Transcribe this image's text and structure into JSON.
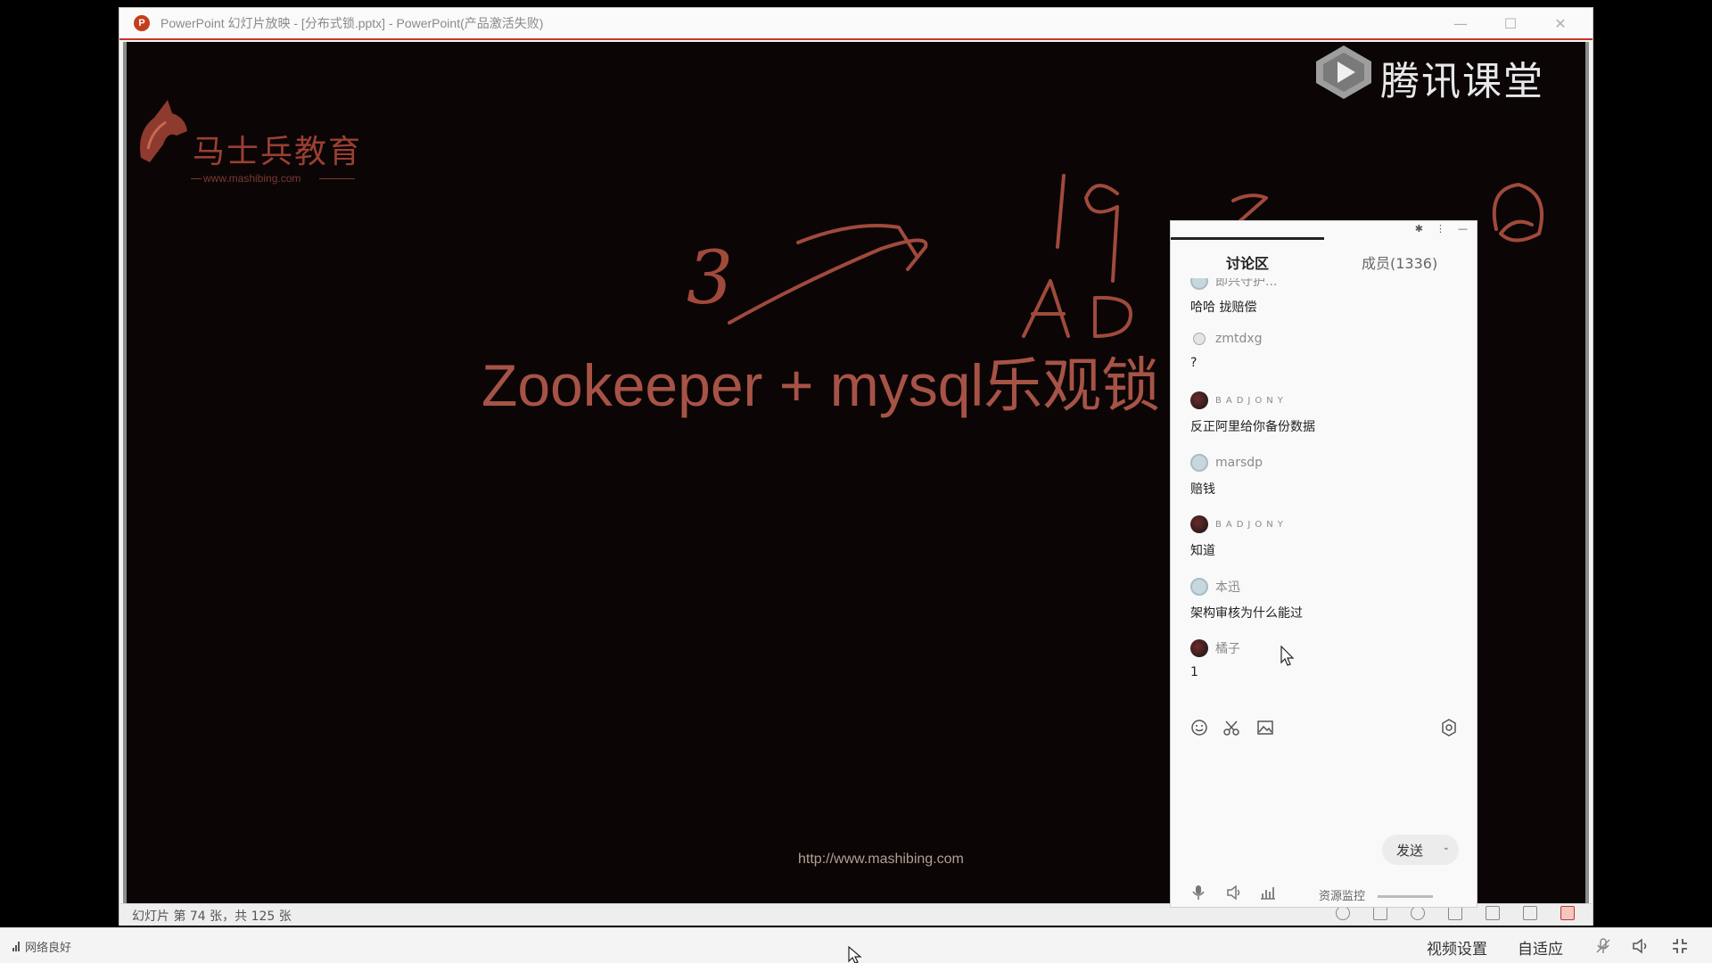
{
  "window": {
    "title": "PowerPoint 幻灯片放映 - [分布式锁.pptx] - PowerPoint(产品激活失败)",
    "app_icon_letter": "P",
    "minimize_glyph": "—",
    "maximize_glyph": "☐",
    "close_glyph": "✕"
  },
  "slide": {
    "logo_text": "马士兵教育",
    "logo_url": "www.mashibing.com",
    "watermark_text": "腾讯课堂",
    "heading": "Zookeeper + mysql乐观锁",
    "footer_url": "http://www.mashibing.com",
    "handwriting": [
      "3",
      "19",
      "AD",
      "@"
    ]
  },
  "statusbar": {
    "slide_count": "幻灯片 第 74 张，共 125 张"
  },
  "chat": {
    "tab_discuss": "讨论区",
    "tab_members": "成员(1336)",
    "messages": [
      {
        "name": "即兴守护...",
        "text": "哈哈 拢赔偿",
        "avatar": "light"
      },
      {
        "name": "zmtdxg",
        "text": "?",
        "avatar": "small"
      },
      {
        "name": "BADJONY",
        "text": "反正阿里给你备份数据",
        "avatar": "dark"
      },
      {
        "name": "marsdp",
        "text": "赔钱",
        "avatar": "light"
      },
      {
        "name": "BADJONY",
        "text": "知道",
        "avatar": "dark"
      },
      {
        "name": "本迅",
        "text": "架构审核为什么能过",
        "avatar": "light"
      },
      {
        "name": "橘子",
        "text": "1",
        "avatar": "dark"
      }
    ],
    "send_label": "发送",
    "send_caret": "⌄",
    "resource_monitor": "资源监控"
  },
  "taskbar": {
    "network_status": "网络良好",
    "video_settings": "视频设置",
    "auto_fit": "自适应"
  },
  "colors": {
    "slide_bg": "#0b0506",
    "heading": "#a65346",
    "accent_red": "#c0392b",
    "ink": "#a04a3c"
  }
}
